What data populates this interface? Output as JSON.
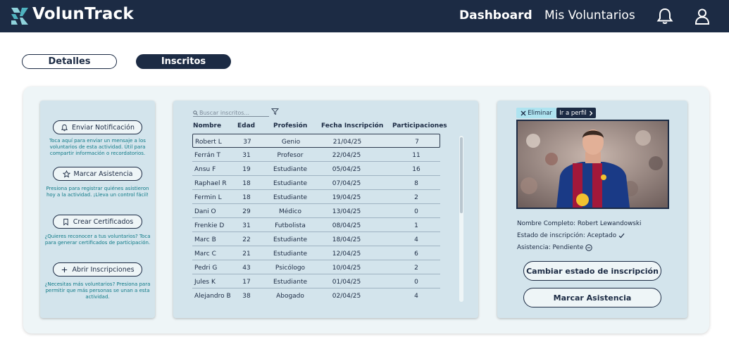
{
  "header": {
    "brand": "VolunTrack",
    "nav": {
      "dashboard": "Dashboard",
      "volunteers": "Mis Voluntarios"
    }
  },
  "tabs": {
    "details": "Detalles",
    "inscritos": "Inscritos"
  },
  "actions": [
    {
      "label": "Enviar Notificación",
      "desc": "Toca aquí para enviar un mensaje a los voluntarios de esta actividad. Útil para compartir información o recordatorios."
    },
    {
      "label": "Marcar Asistencia",
      "desc": "Presiona para registrar quiénes asistieron hoy a la actividad. ¡Lleva un control fácil!"
    },
    {
      "label": "Crear Certificados",
      "desc": "¿Quieres reconocer a tus voluntarios? Toca para generar certificados de participación."
    },
    {
      "label": "Abrir Inscripciones",
      "desc": "¿Necesitas más voluntarios? Presiona para permitir que más personas se unan a esta actividad."
    }
  ],
  "table": {
    "search_placeholder": "Buscar inscritos...",
    "headers": {
      "name": "Nombre",
      "age": "Edad",
      "prof": "Profesión",
      "date": "Fecha Inscripción",
      "part": "Participaciones"
    },
    "rows": [
      {
        "name": "Robert L",
        "age": "37",
        "prof": "Genio",
        "date": "21/04/25",
        "part": "7"
      },
      {
        "name": "Ferrán T",
        "age": "31",
        "prof": "Profesor",
        "date": "22/04/25",
        "part": "11"
      },
      {
        "name": "Ansu F",
        "age": "19",
        "prof": "Estudiante",
        "date": "05/04/25",
        "part": "16"
      },
      {
        "name": "Raphael R",
        "age": "18",
        "prof": "Estudiante",
        "date": "07/04/25",
        "part": "8"
      },
      {
        "name": "Fermin L",
        "age": "18",
        "prof": "Estudiante",
        "date": "19/04/25",
        "part": "2"
      },
      {
        "name": "Dani O",
        "age": "29",
        "prof": "Médico",
        "date": "13/04/25",
        "part": "0"
      },
      {
        "name": "Frenkie D",
        "age": "31",
        "prof": "Futbolista",
        "date": "08/04/25",
        "part": "1"
      },
      {
        "name": "Marc B",
        "age": "22",
        "prof": "Estudiante",
        "date": "18/04/25",
        "part": "4"
      },
      {
        "name": "Marc C",
        "age": "21",
        "prof": "Estudiante",
        "date": "12/04/25",
        "part": "6"
      },
      {
        "name": "Pedri G",
        "age": "43",
        "prof": "Psicólogo",
        "date": "10/04/25",
        "part": "2"
      },
      {
        "name": "Jules K",
        "age": "17",
        "prof": "Estudiante",
        "date": "01/04/25",
        "part": "0"
      },
      {
        "name": "Alejandro B",
        "age": "38",
        "prof": "Abogado",
        "date": "02/04/25",
        "part": "4"
      }
    ]
  },
  "profile": {
    "delete_label": "Eliminar",
    "profile_label": "Ir a perfil",
    "full_name": "Nombre Completo: Robert Lewandowski",
    "status": "Estado de inscripción: Aceptado",
    "attendance": "Asistencia: Pendiente",
    "change_status_label": "Cambiar estado de inscripción",
    "mark_attendance_label": "Marcar Asistencia"
  }
}
